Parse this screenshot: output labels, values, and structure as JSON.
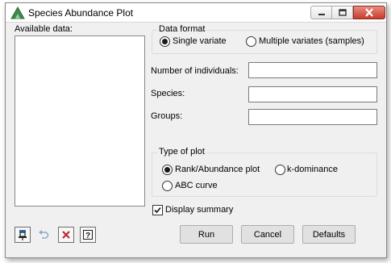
{
  "window": {
    "title": "Species Abundance Plot",
    "accent": "#3f8a4b",
    "close_color": "#c63d2c",
    "icons": [
      "minimize-icon",
      "maximize-icon",
      "close-icon"
    ]
  },
  "available_data": {
    "label": "Available data:",
    "items": []
  },
  "data_format": {
    "title": "Data format",
    "options": [
      {
        "label": "Single variate",
        "selected": true
      },
      {
        "label": "Multiple variates (samples)",
        "selected": false
      }
    ]
  },
  "fields": {
    "number_of_individuals": {
      "label": "Number of individuals:",
      "value": ""
    },
    "species": {
      "label": "Species:",
      "value": ""
    },
    "groups": {
      "label": "Groups:",
      "value": ""
    }
  },
  "type_of_plot": {
    "title": "Type of plot",
    "options": [
      {
        "label": "Rank/Abundance plot",
        "selected": true
      },
      {
        "label": "k-dominance",
        "selected": false
      },
      {
        "label": "ABC curve",
        "selected": false
      }
    ]
  },
  "display_summary": {
    "label": "Display summary",
    "checked": true
  },
  "toolbar": {
    "icons": [
      "pin-icon",
      "undo-icon",
      "clear-icon",
      "help-icon"
    ]
  },
  "buttons": {
    "run": "Run",
    "cancel": "Cancel",
    "defaults": "Defaults"
  }
}
